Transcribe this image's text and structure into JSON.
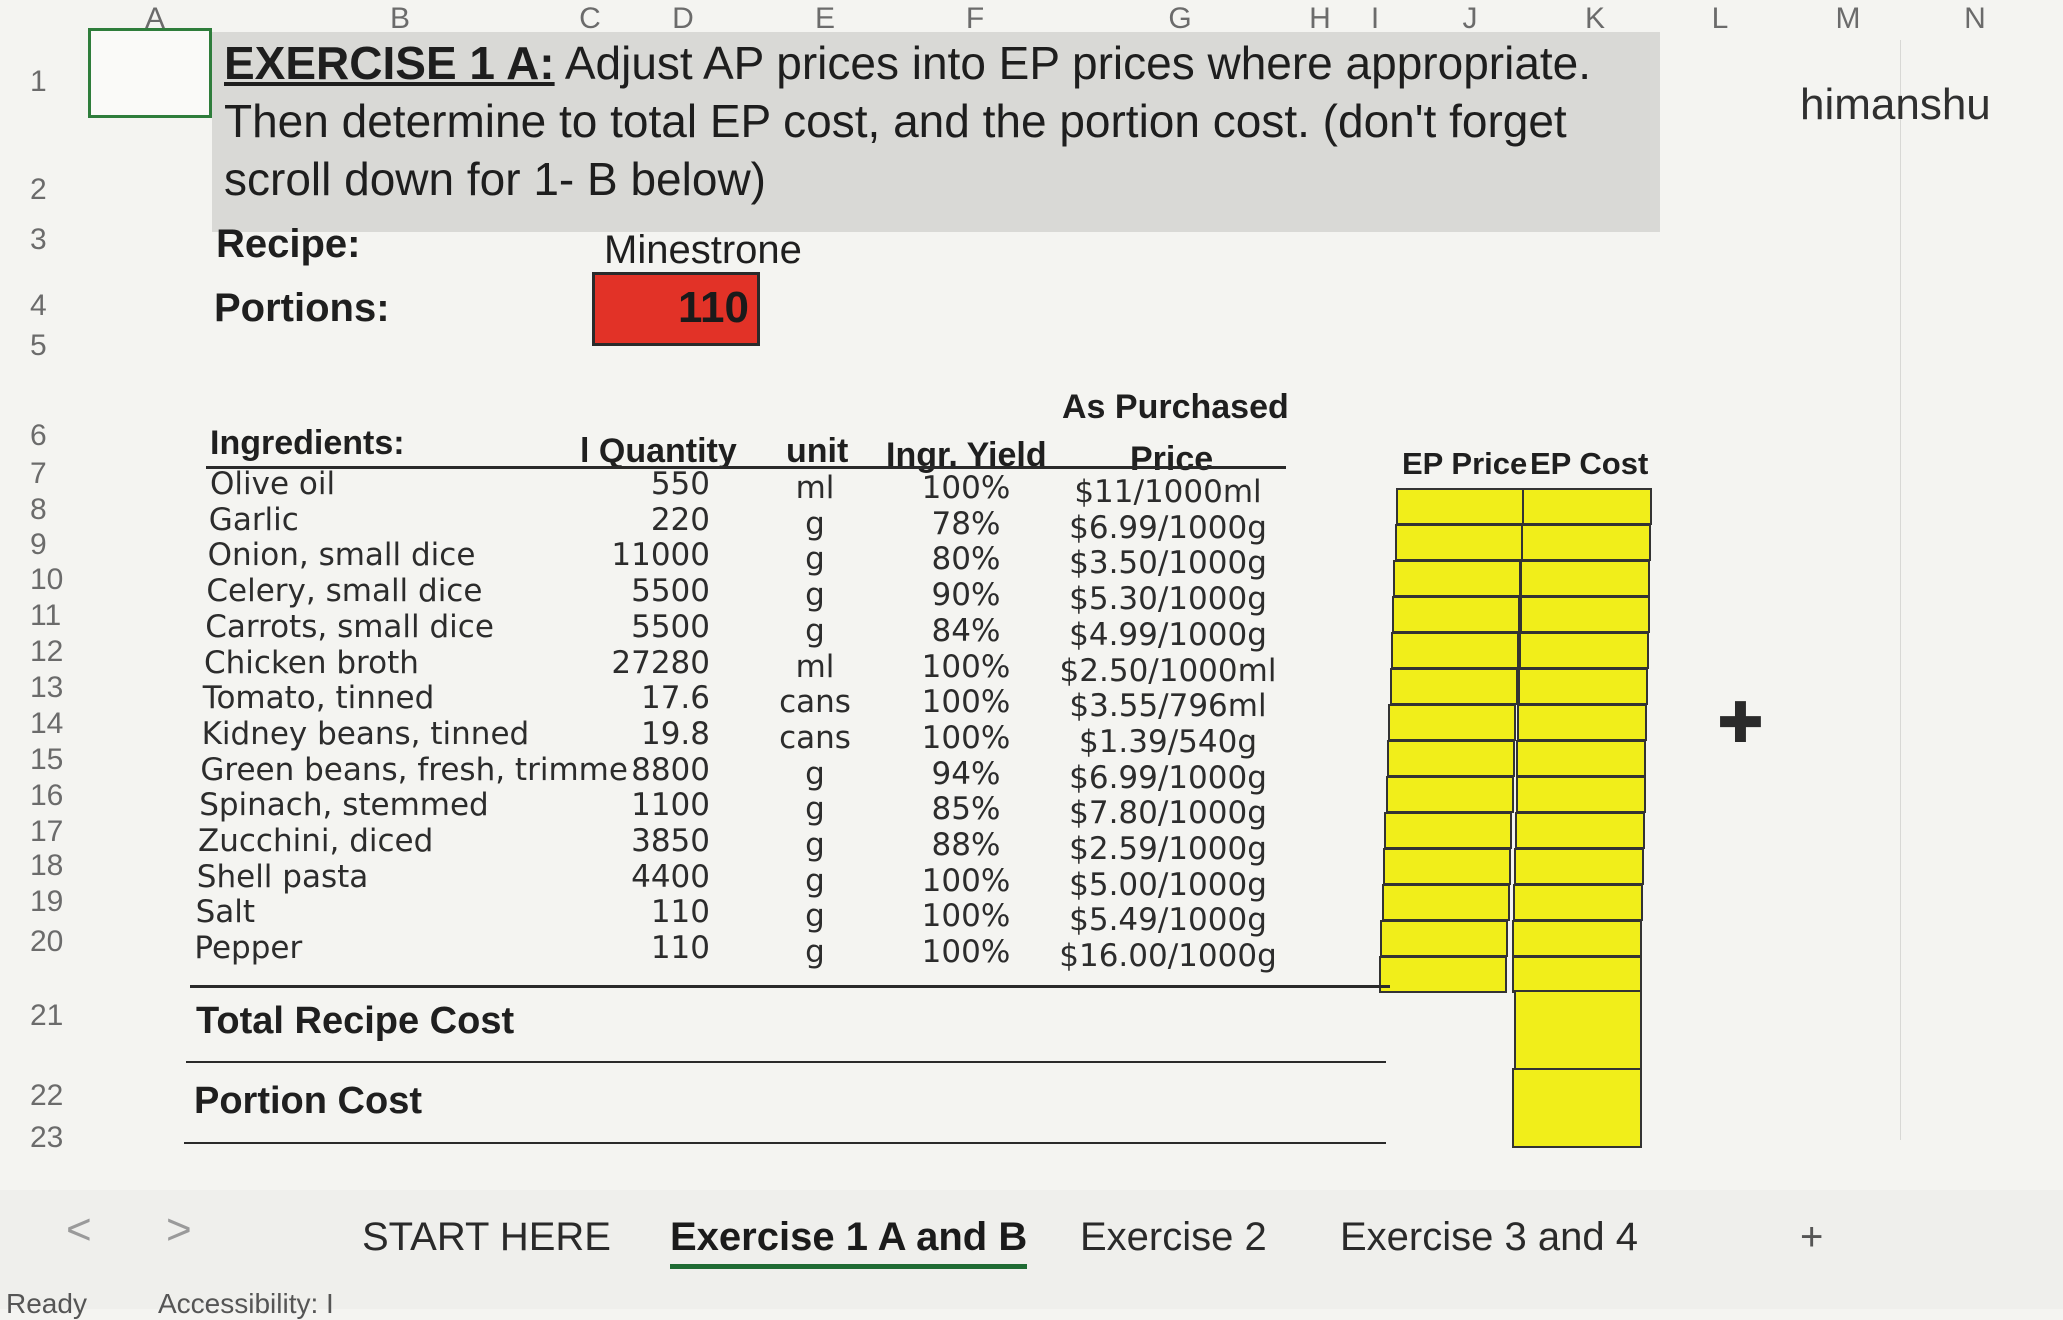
{
  "columns": [
    "A",
    "B",
    "C",
    "D",
    "E",
    "F",
    "G",
    "H",
    "I",
    "J",
    "K",
    "L",
    "M",
    "N"
  ],
  "rows": [
    "1",
    "2",
    "3",
    "4",
    "5",
    "6",
    "7",
    "8",
    "9",
    "10",
    "11",
    "12",
    "13",
    "14",
    "15",
    "16",
    "17",
    "18",
    "19",
    "20",
    "21",
    "22",
    "23"
  ],
  "title": {
    "lead": "EXERCISE 1 A:",
    "text": " Adjust AP prices into EP prices where appropriate. Then determine to total EP cost, and the portion cost. (don't forget scroll down for 1- B below)"
  },
  "recipe": {
    "label": "Recipe:",
    "value": "Minestrone"
  },
  "portions": {
    "label": "Portions:",
    "value": "110"
  },
  "user_name": "himanshu",
  "table": {
    "header_top": "As Purchased",
    "headers": {
      "ingredients": "Ingredients:",
      "quantity": "l Quantity",
      "unit": "unit",
      "yield": "Ingr. Yield",
      "price": "Price",
      "ep_price": "EP Price",
      "ep_cost": "EP Cost"
    },
    "rows": [
      {
        "name": "Olive oil",
        "qty": "550",
        "unit": "ml",
        "yield": "100%",
        "price": "$11/1000ml"
      },
      {
        "name": "Garlic",
        "qty": "220",
        "unit": "g",
        "yield": "78%",
        "price": "$6.99/1000g"
      },
      {
        "name": "Onion, small dice",
        "qty": "11000",
        "unit": "g",
        "yield": "80%",
        "price": "$3.50/1000g"
      },
      {
        "name": "Celery, small dice",
        "qty": "5500",
        "unit": "g",
        "yield": "90%",
        "price": "$5.30/1000g"
      },
      {
        "name": "Carrots, small dice",
        "qty": "5500",
        "unit": "g",
        "yield": "84%",
        "price": "$4.99/1000g"
      },
      {
        "name": "Chicken broth",
        "qty": "27280",
        "unit": "ml",
        "yield": "100%",
        "price": "$2.50/1000ml"
      },
      {
        "name": "Tomato, tinned",
        "qty": "17.6",
        "unit": "cans",
        "yield": "100%",
        "price": "$3.55/796ml"
      },
      {
        "name": "Kidney beans, tinned",
        "qty": "19.8",
        "unit": "cans",
        "yield": "100%",
        "price": "$1.39/540g"
      },
      {
        "name": "Green beans, fresh, trimme",
        "qty": "8800",
        "unit": "g",
        "yield": "94%",
        "price": "$6.99/1000g"
      },
      {
        "name": "Spinach, stemmed",
        "qty": "1100",
        "unit": "g",
        "yield": "85%",
        "price": "$7.80/1000g"
      },
      {
        "name": "Zucchini, diced",
        "qty": "3850",
        "unit": "g",
        "yield": "88%",
        "price": "$2.59/1000g"
      },
      {
        "name": "Shell pasta",
        "qty": "4400",
        "unit": "g",
        "yield": "100%",
        "price": "$5.00/1000g"
      },
      {
        "name": "Salt",
        "qty": "110",
        "unit": "g",
        "yield": "100%",
        "price": "$5.49/1000g"
      },
      {
        "name": "Pepper",
        "qty": "110",
        "unit": "g",
        "yield": "100%",
        "price": "$16.00/1000g"
      }
    ]
  },
  "totals": {
    "total_label": "Total Recipe Cost",
    "portion_label": "Portion Cost"
  },
  "sheet_tabs": {
    "tabs": [
      "START HERE",
      "Exercise 1 A and B",
      "Exercise 2",
      "Exercise 3 and 4"
    ],
    "active_index": 1,
    "add": "+",
    "prev": "<",
    "next": ">"
  },
  "status": {
    "ready": "Ready",
    "accessibility": "Accessibility: I"
  },
  "colors": {
    "portions_fill": "#e23227",
    "input_fill": "#f1ee1a",
    "title_band": "#d9d9d6"
  }
}
